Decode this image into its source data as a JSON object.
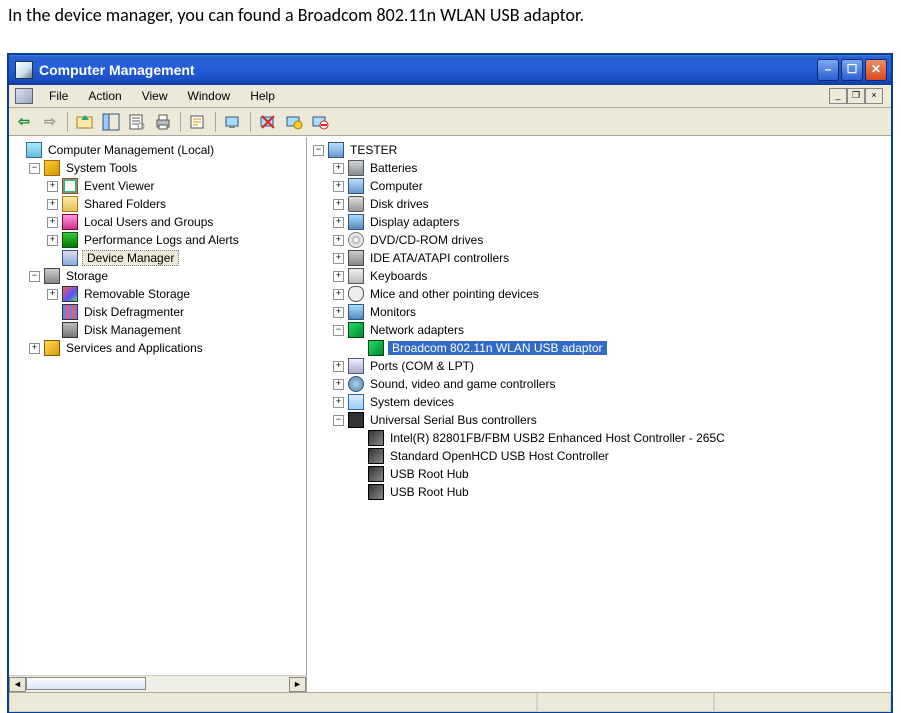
{
  "caption": "In the device manager, you can found a Broadcom 802.11n WLAN USB adaptor.",
  "window": {
    "title": "Computer Management",
    "menus": [
      "File",
      "Action",
      "View",
      "Window",
      "Help"
    ]
  },
  "left_tree": {
    "root": "Computer Management (Local)",
    "items": [
      {
        "label": "System Tools",
        "expander": "-",
        "children": [
          {
            "label": "Event Viewer",
            "expander": "+"
          },
          {
            "label": "Shared Folders",
            "expander": "+"
          },
          {
            "label": "Local Users and Groups",
            "expander": "+"
          },
          {
            "label": "Performance Logs and Alerts",
            "expander": "+"
          },
          {
            "label": "Device Manager",
            "expander": "",
            "selected": true
          }
        ]
      },
      {
        "label": "Storage",
        "expander": "-",
        "children": [
          {
            "label": "Removable Storage",
            "expander": "+"
          },
          {
            "label": "Disk Defragmenter",
            "expander": ""
          },
          {
            "label": "Disk Management",
            "expander": ""
          }
        ]
      },
      {
        "label": "Services and Applications",
        "expander": "+"
      }
    ]
  },
  "right_tree": {
    "root": "TESTER",
    "items": [
      {
        "label": "Batteries",
        "expander": "+",
        "icon": "battery"
      },
      {
        "label": "Computer",
        "expander": "+",
        "icon": "computer"
      },
      {
        "label": "Disk drives",
        "expander": "+",
        "icon": "disk"
      },
      {
        "label": "Display adapters",
        "expander": "+",
        "icon": "display"
      },
      {
        "label": "DVD/CD-ROM drives",
        "expander": "+",
        "icon": "dvd"
      },
      {
        "label": "IDE ATA/ATAPI controllers",
        "expander": "+",
        "icon": "ide"
      },
      {
        "label": "Keyboards",
        "expander": "+",
        "icon": "kb"
      },
      {
        "label": "Mice and other pointing devices",
        "expander": "+",
        "icon": "mouse"
      },
      {
        "label": "Monitors",
        "expander": "+",
        "icon": "display"
      },
      {
        "label": "Network adapters",
        "expander": "-",
        "icon": "net",
        "children": [
          {
            "label": "Broadcom 802.11n WLAN USB adaptor",
            "icon": "net",
            "selected": true
          }
        ]
      },
      {
        "label": "Ports (COM & LPT)",
        "expander": "+",
        "icon": "port"
      },
      {
        "label": "Sound, video and game controllers",
        "expander": "+",
        "icon": "sound"
      },
      {
        "label": "System devices",
        "expander": "+",
        "icon": "sys"
      },
      {
        "label": "Universal Serial Bus controllers",
        "expander": "-",
        "icon": "usb",
        "children": [
          {
            "label": "Intel(R) 82801FB/FBM USB2 Enhanced Host Controller - 265C",
            "icon": "usbctl"
          },
          {
            "label": "Standard OpenHCD USB Host Controller",
            "icon": "usbctl"
          },
          {
            "label": "USB Root Hub",
            "icon": "usbctl"
          },
          {
            "label": "USB Root Hub",
            "icon": "usbctl"
          }
        ]
      }
    ]
  }
}
